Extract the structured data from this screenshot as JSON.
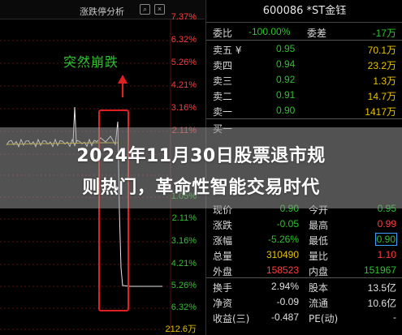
{
  "chart": {
    "title": "涨跌停分析",
    "annotation": "突然崩跌",
    "pct_labels": [
      "7.37%",
      "6.32%",
      "5.26%",
      "4.21%",
      "3.16%",
      "2.11%",
      "1.05%",
      "2.11%",
      "3.16%",
      "4.21%",
      "5.26%",
      "6.32%"
    ],
    "pct_colors": [
      "#ff3b3b",
      "#ff3b3b",
      "#ff3b3b",
      "#ff3b3b",
      "#ff3b3b",
      "#ff3b3b",
      "#2ec22e",
      "#2ec22e",
      "#2ec22e",
      "#2ec22e",
      "#2ec22e",
      "#2ec22e"
    ],
    "volume_label": "212.6万",
    "volume_value": "0.00"
  },
  "quote": {
    "stock_title": "600086 *ST金钰",
    "weibi_label": "委比",
    "weibi_value": "-100.00%",
    "weicha_label": "委差",
    "weicha_value": "-17万",
    "asks": [
      {
        "label": "卖五 ¥",
        "price": "0.95",
        "vol": "70.1万"
      },
      {
        "label": "卖四",
        "price": "0.94",
        "vol": "23.2万"
      },
      {
        "label": "卖三",
        "price": "0.92",
        "vol": "1.3万"
      },
      {
        "label": "卖二",
        "price": "0.91",
        "vol": "14.7万"
      },
      {
        "label": "卖一",
        "price": "0.90",
        "vol": "1417万"
      }
    ],
    "bid_partial": "买一",
    "stats": [
      {
        "l1": "现价",
        "v1": "0.90",
        "l2": "今开",
        "v2": "0.95"
      },
      {
        "l1": "涨跌",
        "v1": "-0.05",
        "l2": "最高",
        "v2": "0.99"
      },
      {
        "l1": "涨幅",
        "v1": "-5.26%",
        "l2": "最低",
        "v2": "0.90"
      },
      {
        "l1": "总量",
        "v1": "310490",
        "l2": "量比",
        "v2": "1.10"
      },
      {
        "l1": "外盘",
        "v1": "158523",
        "l2": "内盘",
        "v2": "151967"
      }
    ],
    "stats2": [
      {
        "l1": "换手",
        "v1": "2.94%",
        "l2": "股本",
        "v2": "13.5亿"
      },
      {
        "l1": "净资",
        "v1": "-0.09",
        "l2": "流通",
        "v2": "10.6亿"
      },
      {
        "l1": "收益(三)",
        "v1": "-0.487",
        "l2": "PE(动)",
        "v2": "-"
      }
    ]
  },
  "banner": {
    "line1": "2024年11月30日股票退市规",
    "line2": "则热门，革命性智能交易时代"
  }
}
